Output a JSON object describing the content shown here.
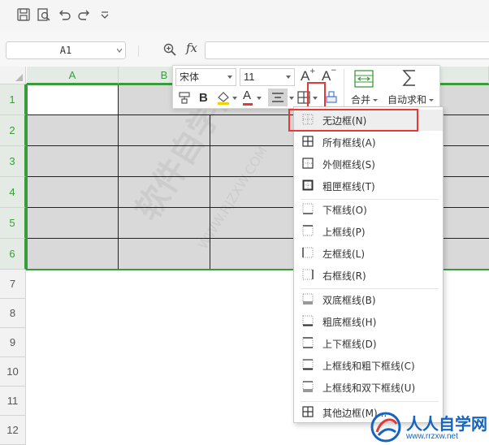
{
  "quick_access": {
    "icons": [
      "save-icon",
      "print-preview-icon",
      "undo-icon",
      "redo-icon",
      "customize-dropdown-icon"
    ]
  },
  "formula_bar": {
    "name_box": "A1",
    "fx_label": "fx",
    "formula_value": ""
  },
  "grid": {
    "columns": [
      "A",
      "B"
    ],
    "rows": [
      "1",
      "2",
      "3",
      "4",
      "5",
      "6",
      "7",
      "8",
      "9",
      "10",
      "11",
      "12"
    ],
    "selected_columns": [
      "A",
      "B"
    ],
    "selected_rows": [
      "1",
      "2",
      "3",
      "4",
      "5",
      "6"
    ]
  },
  "mini_toolbar": {
    "font_name": "宋体",
    "font_size": "11",
    "bold_label": "B",
    "font_color_label": "A",
    "font_color": "#e53935",
    "increase_font_label": "A",
    "decrease_font_label": "A",
    "merge_label": "合并",
    "autosum_label": "自动求和"
  },
  "border_menu": {
    "items": [
      {
        "label": "无边框(N)",
        "icon": "no-border-icon"
      },
      {
        "label": "所有框线(A)",
        "icon": "all-borders-icon"
      },
      {
        "label": "外侧框线(S)",
        "icon": "outside-borders-icon"
      },
      {
        "label": "粗匣框线(T)",
        "icon": "thick-box-border-icon"
      },
      {
        "label": "下框线(O)",
        "icon": "bottom-border-icon"
      },
      {
        "label": "上框线(P)",
        "icon": "top-border-icon"
      },
      {
        "label": "左框线(L)",
        "icon": "left-border-icon"
      },
      {
        "label": "右框线(R)",
        "icon": "right-border-icon"
      },
      {
        "label": "双底框线(B)",
        "icon": "double-bottom-border-icon"
      },
      {
        "label": "粗底框线(H)",
        "icon": "thick-bottom-border-icon"
      },
      {
        "label": "上下框线(D)",
        "icon": "top-bottom-border-icon"
      },
      {
        "label": "上框线和粗下框线(C)",
        "icon": "top-thick-bottom-border-icon"
      },
      {
        "label": "上框线和双下框线(U)",
        "icon": "top-double-bottom-border-icon"
      },
      {
        "label": "其他边框(M)...",
        "icon": "more-borders-icon"
      }
    ]
  },
  "watermark": {
    "text": "软件自学网",
    "url": "WWW.RJZXW.COM"
  },
  "site_logo": {
    "name": "人人自学网",
    "url": "www.rrzxw.net"
  },
  "colors": {
    "selection_green": "#3a9b3a",
    "highlight_red": "#e53935",
    "selection_fill": "#d9d9d9"
  }
}
